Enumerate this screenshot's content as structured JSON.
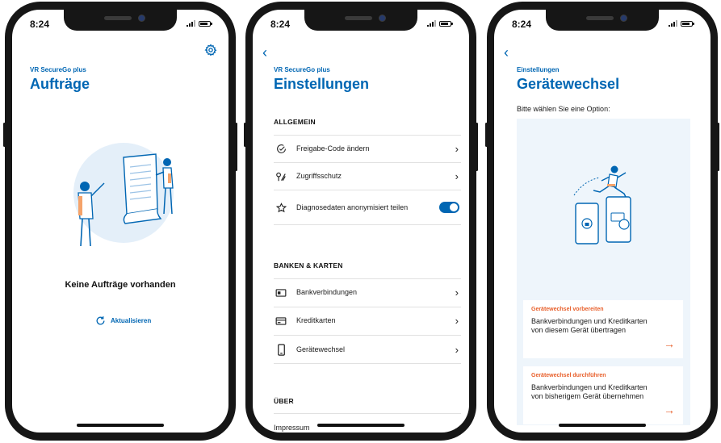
{
  "status": {
    "time": "8:24"
  },
  "screen1": {
    "eyebrow": "VR SecureGo plus",
    "title": "Aufträge",
    "empty_text": "Keine Aufträge vorhanden",
    "refresh_label": "Aktualisieren",
    "icons": {
      "settings": "gear-icon",
      "refresh": "refresh-icon"
    }
  },
  "screen2": {
    "eyebrow": "VR SecureGo plus",
    "title": "Einstellungen",
    "sections": {
      "general": "ALLGEMEIN",
      "banks": "BANKEN & KARTEN",
      "about": "ÜBER"
    },
    "items": {
      "release_code": "Freigabe-Code ändern",
      "access": "Zugriffsschutz",
      "diagnostics": "Diagnosedaten anonymisiert teilen",
      "bank_connections": "Bankverbindungen",
      "credit_cards": "Kreditkarten",
      "device_change": "Gerätewechsel",
      "imprint": "Impressum"
    },
    "diagnostics_enabled": true
  },
  "screen3": {
    "eyebrow": "Einstellungen",
    "title": "Gerätewechsel",
    "subtitle": "Bitte wählen Sie eine Option:",
    "options": [
      {
        "title": "Gerätewechsel vorbereiten",
        "desc": "Bankverbindungen und Kreditkarten von diesem Gerät übertragen"
      },
      {
        "title": "Gerätewechsel durchführen",
        "desc": "Bankverbindungen und Kreditkarten von bisherigem Gerät übernehmen"
      }
    ]
  },
  "colors": {
    "brand_blue": "#0066b3",
    "accent_orange": "#e8602c",
    "panel_bg": "#eef5fb"
  }
}
